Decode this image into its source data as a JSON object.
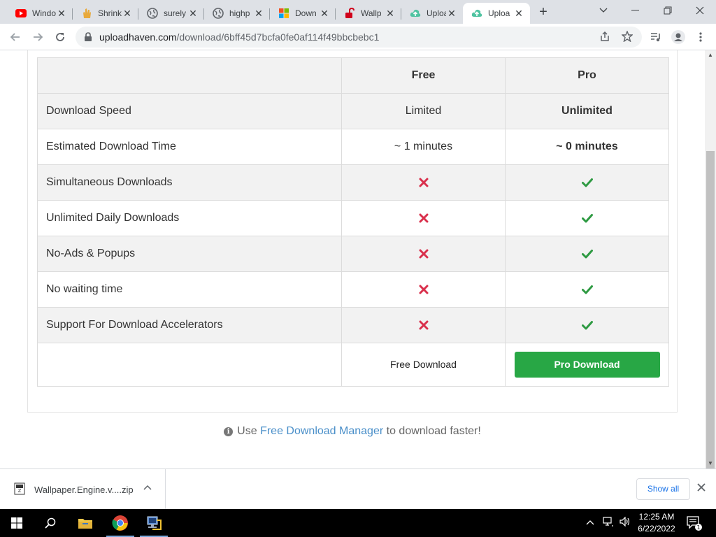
{
  "browser": {
    "tabs": [
      {
        "title": "Windo",
        "icon": "youtube-icon"
      },
      {
        "title": "Shrink",
        "icon": "hand-icon"
      },
      {
        "title": "surely",
        "icon": "globe-icon"
      },
      {
        "title": "highp",
        "icon": "globe-icon"
      },
      {
        "title": "Down",
        "icon": "microsoft-icon"
      },
      {
        "title": "Wallp",
        "icon": "unlock-icon"
      },
      {
        "title": "Uploa",
        "icon": "cloud-upload-icon"
      },
      {
        "title": "Uploa",
        "icon": "cloud-upload-icon",
        "active": true
      }
    ],
    "url_host": "uploadhaven.com",
    "url_path": "/download/6bff45d7bcfa0fe0af114f49bbcbebc1"
  },
  "comparison": {
    "header": {
      "free": "Free",
      "pro": "Pro"
    },
    "rows": [
      {
        "feature": "Download Speed",
        "free": "Limited",
        "pro": "Unlimited"
      },
      {
        "feature": "Estimated Download Time",
        "free": "~ 1 minutes",
        "pro": "~ 0 minutes"
      },
      {
        "feature": "Simultaneous Downloads",
        "free": "no",
        "pro": "yes"
      },
      {
        "feature": "Unlimited Daily Downloads",
        "free": "no",
        "pro": "yes"
      },
      {
        "feature": "No-Ads & Popups",
        "free": "no",
        "pro": "yes"
      },
      {
        "feature": "No waiting time",
        "free": "no",
        "pro": "yes"
      },
      {
        "feature": "Support For Download Accelerators",
        "free": "no",
        "pro": "yes"
      }
    ],
    "free_download_label": "Free Download",
    "pro_download_label": "Pro Download",
    "colors": {
      "pro_green": "#3bab4e",
      "button_green": "#28a745",
      "cross_red": "#d9304c"
    }
  },
  "tip": {
    "prefix": "Use",
    "link": "Free Download Manager",
    "suffix": "to download faster!"
  },
  "download_shelf": {
    "file_name": "Wallpaper.Engine.v....zip",
    "show_all": "Show all"
  },
  "taskbar": {
    "time": "12:25 AM",
    "date": "6/22/2022",
    "notification_count": "1"
  }
}
